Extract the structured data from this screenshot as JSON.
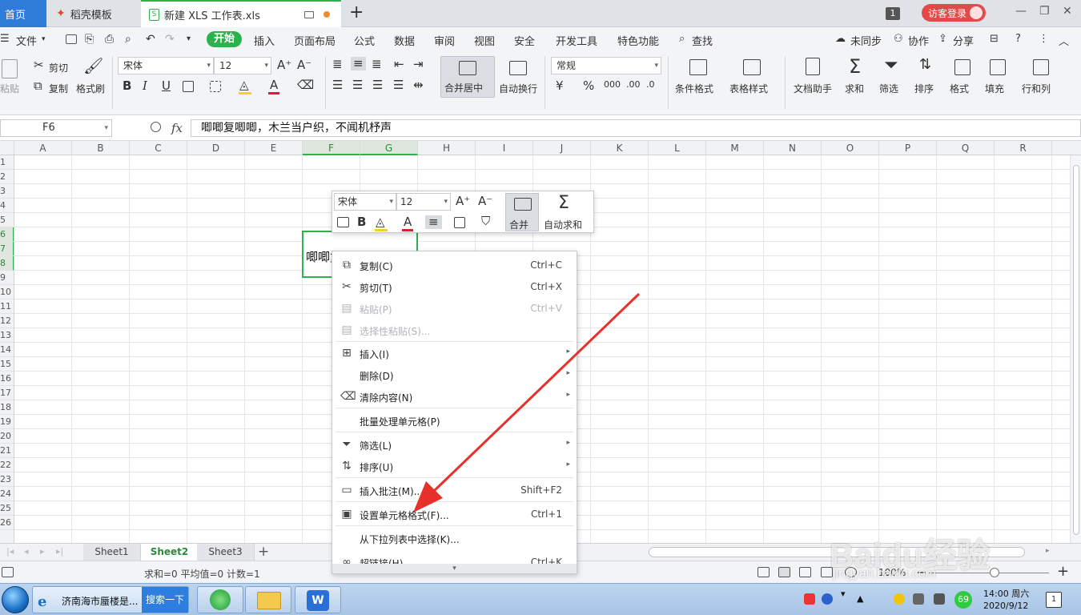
{
  "tabs": {
    "home": "首页",
    "template": "稻壳模板",
    "document": "新建 XLS 工作表.xls",
    "badge": "1",
    "login": "访客登录"
  },
  "menu": {
    "file": "文件",
    "items": [
      "开始",
      "插入",
      "页面布局",
      "公式",
      "数据",
      "审阅",
      "视图",
      "安全",
      "开发工具",
      "特色功能"
    ],
    "search": "查找",
    "sync": "未同步",
    "collab": "协作",
    "share": "分享"
  },
  "ribbon": {
    "paste": "粘贴",
    "cut": "剪切",
    "copy": "复制",
    "format_painter": "格式刷",
    "font_name": "宋体",
    "font_size": "12",
    "merge_center": "合并居中",
    "wrap_text": "自动换行",
    "number_format": "常规",
    "conditional_format": "条件格式",
    "table_style": "表格样式",
    "doc_assistant": "文档助手",
    "sum": "求和",
    "filter": "筛选",
    "sort": "排序",
    "format": "格式",
    "fill": "填充",
    "row_col": "行和列"
  },
  "formula_bar": {
    "cell_ref": "F6",
    "fx": "fx",
    "content": "唧唧复唧唧，木兰当户织，不闻机杼声"
  },
  "grid": {
    "columns": [
      "A",
      "B",
      "C",
      "D",
      "E",
      "F",
      "G",
      "H",
      "I",
      "J",
      "K",
      "L",
      "M",
      "N",
      "O",
      "P",
      "Q",
      "R"
    ],
    "rows": [
      "1",
      "2",
      "3",
      "4",
      "5",
      "6",
      "7",
      "8",
      "9",
      "10",
      "11",
      "12",
      "13",
      "14",
      "15",
      "16",
      "17",
      "18",
      "19",
      "20",
      "21",
      "22",
      "23",
      "24",
      "25",
      "26"
    ],
    "cell_text": "唧唧复唧唧，木兰当"
  },
  "mini_toolbar": {
    "font_name": "宋体",
    "font_size": "12",
    "merge": "合并",
    "autosum": "自动求和"
  },
  "context_menu": {
    "items": [
      {
        "label": "复制(C)",
        "shortcut": "Ctrl+C"
      },
      {
        "label": "剪切(T)",
        "shortcut": "Ctrl+X"
      },
      {
        "label": "粘贴(P)",
        "shortcut": "Ctrl+V"
      },
      {
        "label": "选择性粘贴(S)...",
        "shortcut": ""
      },
      {
        "label": "插入(I)",
        "shortcut": ""
      },
      {
        "label": "删除(D)",
        "shortcut": ""
      },
      {
        "label": "清除内容(N)",
        "shortcut": ""
      },
      {
        "label": "批量处理单元格(P)",
        "shortcut": ""
      },
      {
        "label": "筛选(L)",
        "shortcut": ""
      },
      {
        "label": "排序(U)",
        "shortcut": ""
      },
      {
        "label": "插入批注(M)...",
        "shortcut": "Shift+F2"
      },
      {
        "label": "设置单元格格式(F)...",
        "shortcut": "Ctrl+1"
      },
      {
        "label": "从下拉列表中选择(K)...",
        "shortcut": ""
      },
      {
        "label": "超链接(H)...",
        "shortcut": "Ctrl+K"
      }
    ]
  },
  "sheets": [
    "Sheet1",
    "Sheet2",
    "Sheet3"
  ],
  "status": {
    "summary": "求和=0  平均值=0  计数=1",
    "zoom": "100%"
  },
  "taskbar": {
    "ie_title": "济南海市蜃楼是...",
    "search_btn": "搜索一下",
    "time": "14:00 周六",
    "date": "2020/9/12",
    "badge": "69"
  },
  "watermark": {
    "main": "Baidu经验",
    "sub": "jingyan.baidu.com"
  },
  "colors": {
    "accent_green": "#2bb24c",
    "home_blue": "#2f7bd8",
    "login_red": "#e24a4a",
    "arrow_red": "#e8302b"
  }
}
